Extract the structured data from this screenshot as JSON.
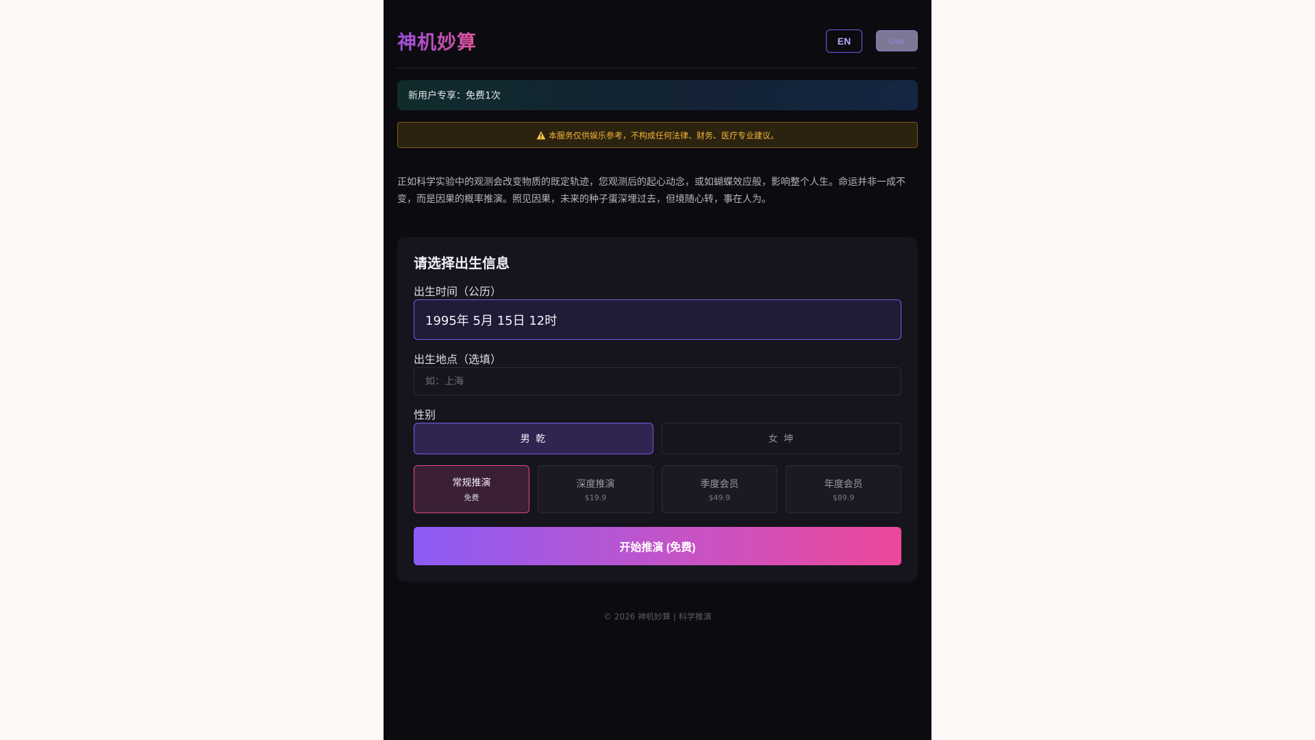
{
  "header": {
    "logo": "神机妙算",
    "lang_label": "EN",
    "user_label": "User"
  },
  "promo": {
    "text": "新用户专享：免费1次"
  },
  "warning": {
    "text": "本服务仅供娱乐参考，不构成任何法律、财务、医疗专业建议。",
    "icon": "warning-triangle-icon"
  },
  "intro": {
    "text": "正如科学实验中的观测会改变物质的既定轨迹，您观测后的起心动念，或如蝴蝶效应般，影响整个人生。命运并非一成不变，而是因果的概率推演。照见因果，未来的种子蛋深埋过去，但境随心转，事在人为。"
  },
  "form": {
    "title": "请选择出生信息",
    "birth_time_label": "出生时间（公历）",
    "birth_time_value": "1995年 5月 15日 12时",
    "birth_place_label": "出生地点（选填）",
    "birth_place_placeholder": "如：上海",
    "birth_place_value": "",
    "gender_label": "性别",
    "gender_options": [
      {
        "label": "男 乾",
        "selected": true
      },
      {
        "label": "女 坤",
        "selected": false
      }
    ],
    "plans": [
      {
        "name": "常规推演",
        "price": "免费",
        "selected": true
      },
      {
        "name": "深度推演",
        "price": "$19.9",
        "selected": false
      },
      {
        "name": "季度会员",
        "price": "$49.9",
        "selected": false
      },
      {
        "name": "年度会员",
        "price": "$89.9",
        "selected": false
      }
    ],
    "submit_label": "开始推演 (免费)"
  },
  "footer": {
    "text": "© 2026 神机妙算 | 科学推演"
  },
  "colors": {
    "page_bg": "#0c0b10",
    "card_bg": "#16151d",
    "accent_purple": "#7b5ce8",
    "accent_pink": "#ec4899",
    "warning": "#f3b53a"
  }
}
